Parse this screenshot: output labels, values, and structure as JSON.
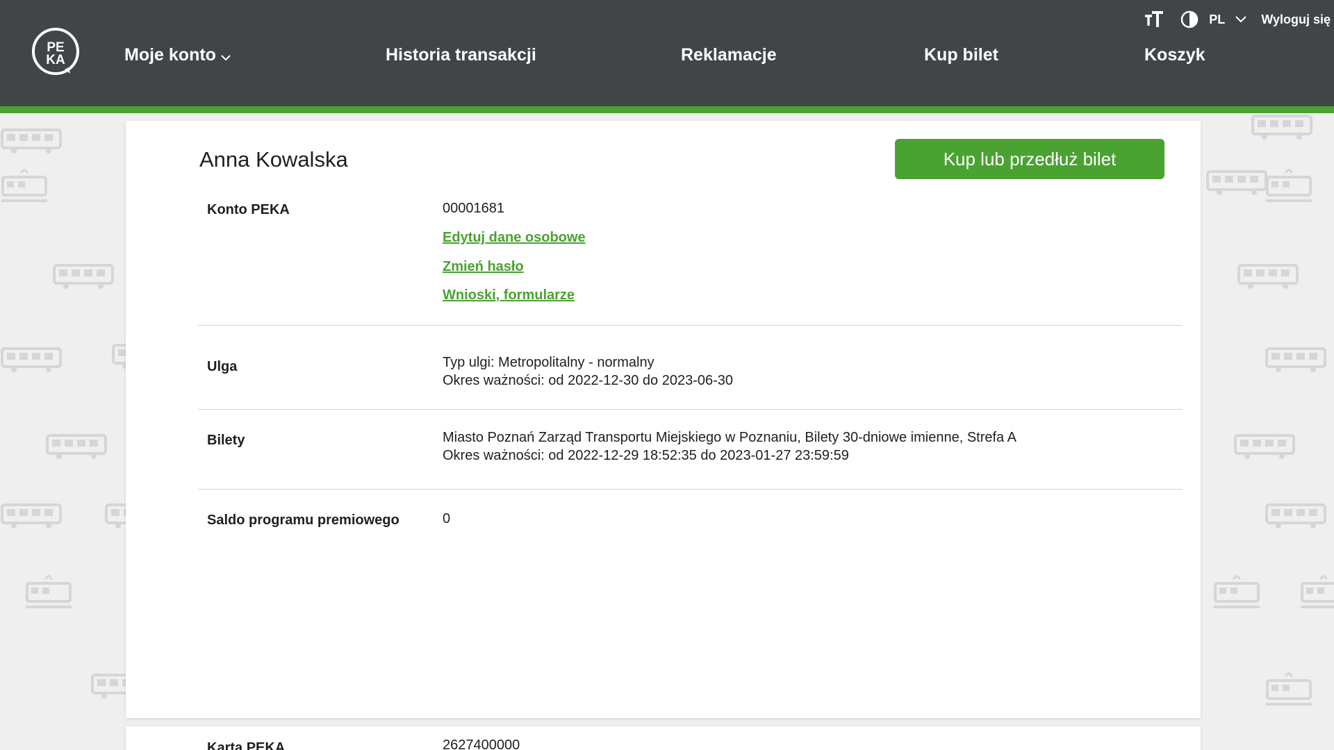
{
  "header": {
    "logo_text_top": "PE",
    "logo_text_bottom": "KA",
    "nav": {
      "my_account": "Moje konto",
      "history": "Historia transakcji",
      "complaints": "Reklamacje",
      "buy_ticket": "Kup bilet",
      "cart": "Koszyk"
    },
    "lang": "PL",
    "logout": "Wyloguj się",
    "icons": [
      "font-size-icon",
      "contrast-icon",
      "chevron-down-icon"
    ]
  },
  "account": {
    "name": "Anna Kowalska",
    "buy_button": "Kup lub przedłuż bilet",
    "peka_label": "Konto PEKA",
    "peka_number": "00001681",
    "links": {
      "edit": "Edytuj dane osobowe",
      "password": "Zmień hasło",
      "forms": "Wnioski, formularze"
    },
    "discount_label": "Ulga",
    "discount_type": "Typ ulgi: Metropolitalny - normalny",
    "discount_validity": "Okres ważności: od 2022-12-30 do 2023-06-30",
    "tickets_label": "Bilety",
    "ticket_desc": "Miasto Poznań Zarząd Transportu Miejskiego w Poznaniu, Bilety 30-dniowe imienne, Strefa A",
    "ticket_validity": "Okres ważności: od 2022-12-29 18:52:35 do 2023-01-27 23:59:59",
    "points_label": "Saldo programu premiowego",
    "points_value": "0"
  },
  "card2": {
    "label": "Karta PEKA",
    "number": "2627400000"
  },
  "colors": {
    "header_bg": "#424548",
    "accent_green": "#4aa231",
    "page_bg": "#efeff0"
  }
}
